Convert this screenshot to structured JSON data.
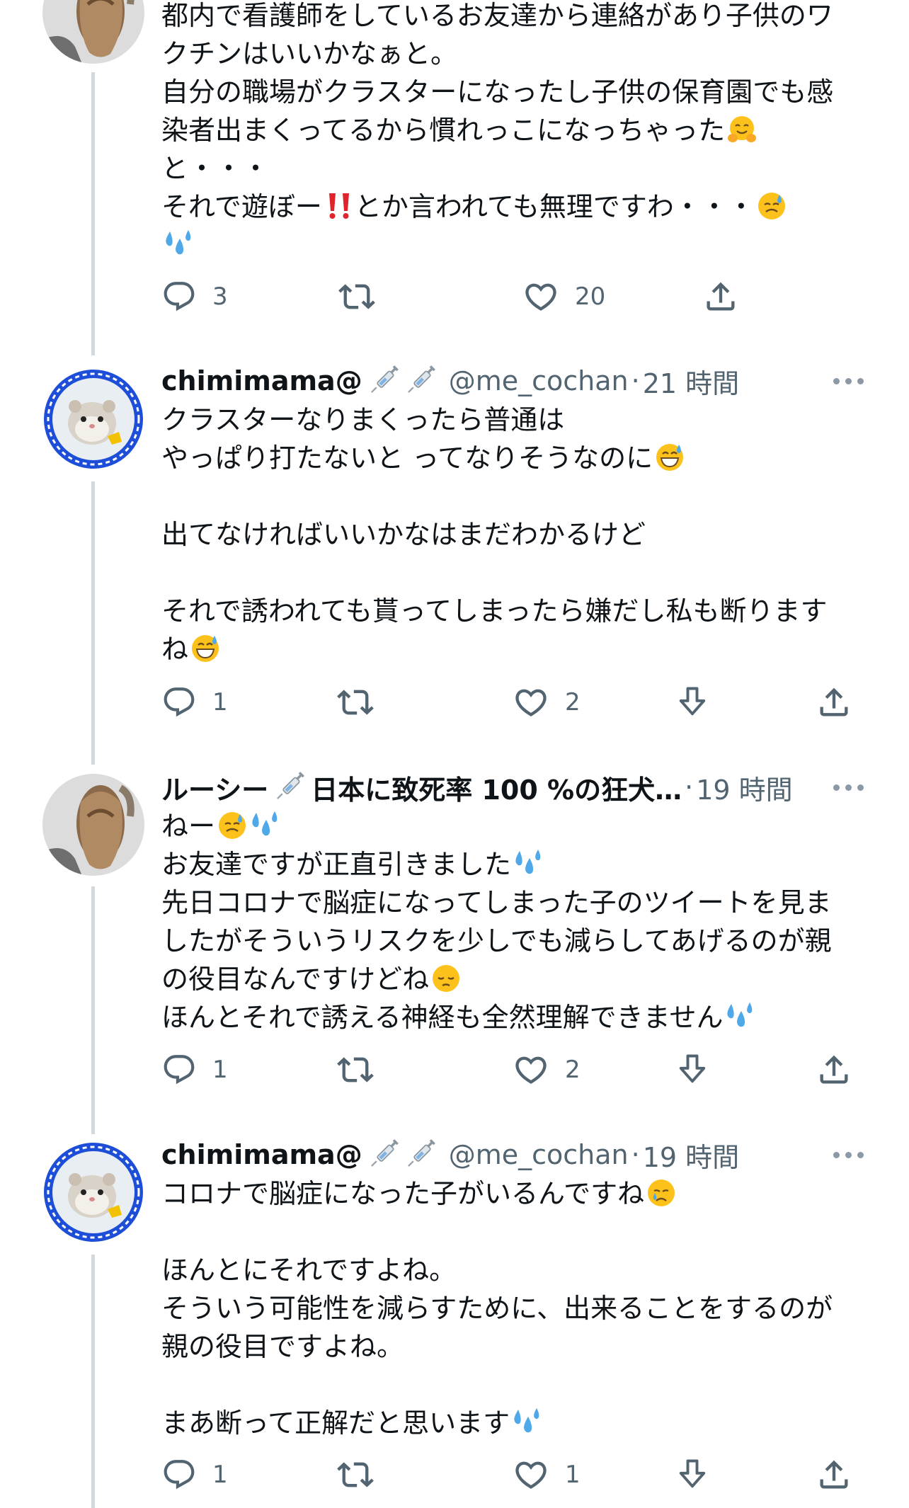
{
  "tweets": [
    {
      "name": "",
      "handle": "",
      "time": "",
      "lines": [
        "都内で看護師をしているお友達から連絡があり子供のワ",
        "クチンはいいかなぁと。",
        "自分の職場がクラスターになったし子供の保育園でも感",
        "染者出まくってるから慣れっこになっちゃった",
        "と・・・",
        "それで遊ぼー",
        "とか言われても無理ですわ・・・"
      ],
      "replies": "3",
      "retweets": "",
      "likes": "20"
    },
    {
      "name": "chimimama@",
      "handle": "@me_cochan",
      "dot": "·",
      "time": "21 時間",
      "lines": [
        "クラスターなりまくったら普通は",
        "やっぱり打たないと ってなりそうなのに",
        "",
        "出てなければいいかなはまだわかるけど",
        "",
        "それで誘われても貰ってしまったら嫌だし私も断ります",
        "ね"
      ],
      "replies": "1",
      "retweets": "",
      "likes": "2"
    },
    {
      "name": "ルーシー",
      "name_rest": "日本に致死率 100 %の狂犬…",
      "dot": "·",
      "time": "19 時間",
      "lines": [
        "ねー",
        "お友達ですが正直引きました",
        "先日コロナで脳症になってしまった子のツイートを見ま",
        "したがそういうリスクを少しでも減らしてあげるのが親",
        "の役目なんですけどね",
        "ほんとそれで誘える神経も全然理解できません"
      ],
      "replies": "1",
      "retweets": "",
      "likes": "2"
    },
    {
      "name": "chimimama@",
      "handle": "@me_cochan",
      "dot": "·",
      "time": "19 時間",
      "lines": [
        "コロナで脳症になった子がいるんですね",
        "",
        "ほんとにそれですよね。",
        "そういう可能性を減らすために、出来ることをするのが",
        "親の役目ですよね。",
        "",
        "まあ断って正解だと思います"
      ],
      "replies": "1",
      "retweets": "",
      "likes": "1"
    }
  ],
  "colors": {
    "text": "#0f1419",
    "secondary": "#536471",
    "thread_line": "#cfd9de",
    "avatar_ring": "#1d4ed8"
  },
  "icons": {
    "reply": "reply-icon",
    "retweet": "retweet-icon",
    "like": "heart-icon",
    "downvote": "downvote-icon",
    "share": "share-icon",
    "more": "more-icon",
    "syringe": "syringe-icon"
  }
}
